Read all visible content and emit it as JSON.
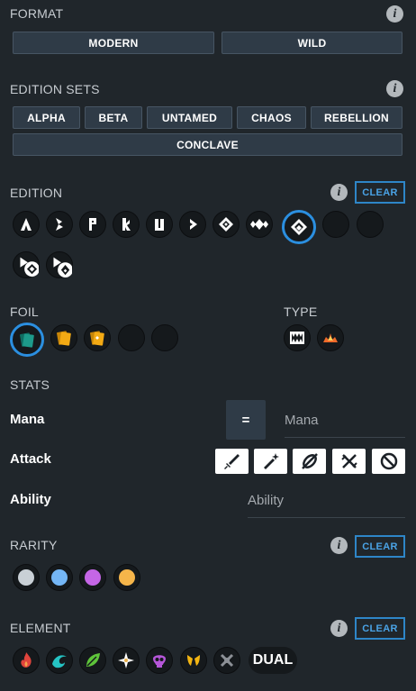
{
  "format": {
    "title": "FORMAT",
    "buttons": [
      "MODERN",
      "WILD"
    ]
  },
  "edition_sets": {
    "title": "EDITION SETS",
    "buttons": [
      "ALPHA",
      "BETA",
      "UNTAMED",
      "CHAOS",
      "REBELLION",
      "CONCLAVE"
    ]
  },
  "edition": {
    "title": "EDITION",
    "clear_label": "CLEAR",
    "icons": [
      "alpha-icon",
      "beta-icon",
      "promo-icon",
      "reward-icon",
      "untamed-icon",
      "dice-icon",
      "chaos-icon",
      "riftwatchers-icon",
      "rebellion-icon",
      "empty-slot-icon",
      "empty-slot-icon",
      "soulbound-icon",
      "soulbound-rebellion-icon"
    ],
    "selected": "rebellion-icon"
  },
  "foil": {
    "title": "FOIL",
    "icons": [
      "regular-foil-icon",
      "gold-foil-icon",
      "gold-arcane-foil-icon",
      "empty-slot-icon",
      "empty-slot-icon"
    ],
    "selected": "regular-foil-icon"
  },
  "type": {
    "title": "TYPE",
    "icons": [
      "monster-icon",
      "summoner-icon"
    ]
  },
  "stats": {
    "title": "STATS",
    "mana_label": "Mana",
    "mana_operator": "=",
    "mana_placeholder": "Mana",
    "attack_label": "Attack",
    "attack_icons": [
      "melee-icon",
      "magic-icon",
      "ranged-icon",
      "no-attack-icon",
      "none-icon"
    ],
    "ability_label": "Ability",
    "ability_placeholder": "Ability"
  },
  "rarity": {
    "title": "RARITY",
    "clear_label": "CLEAR",
    "colors": [
      "#c9d0d6",
      "#74b6f5",
      "#c566e6",
      "#f5b54a"
    ],
    "names": [
      "common-rarity-icon",
      "rare-rarity-icon",
      "epic-rarity-icon",
      "legendary-rarity-icon"
    ]
  },
  "element": {
    "title": "ELEMENT",
    "clear_label": "CLEAR",
    "icons": [
      "fire-icon",
      "water-icon",
      "earth-icon",
      "life-icon",
      "death-icon",
      "dragon-icon",
      "neutral-icon"
    ],
    "dual_label": "DUAL"
  }
}
